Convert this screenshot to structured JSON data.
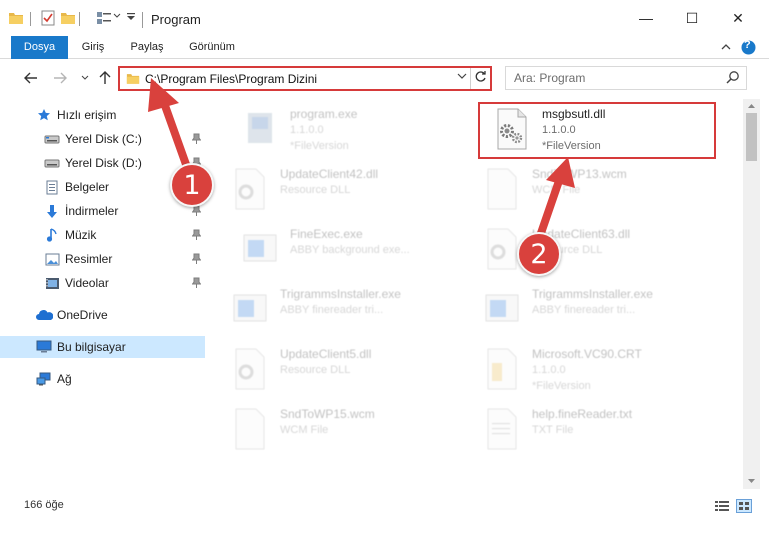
{
  "window": {
    "title": "Program",
    "minimize_glyph": "—",
    "maximize_glyph": "☐",
    "close_glyph": "✕"
  },
  "ribbon": {
    "tabs": [
      "Dosya",
      "Giriş",
      "Paylaş",
      "Görünüm"
    ],
    "help_glyph": "?"
  },
  "address": {
    "path": "C:\\Program Files\\Program Dizini",
    "search_placeholder": "Ara: Program"
  },
  "nav": {
    "items": [
      {
        "label": "Hızlı erişim",
        "icon": "star-icon"
      },
      {
        "label": "Yerel Disk (C:)",
        "icon": "drive-icon",
        "pinned": true
      },
      {
        "label": "Yerel Disk (D:)",
        "icon": "drive-icon",
        "pinned": true
      },
      {
        "label": "Belgeler",
        "icon": "documents-icon",
        "pinned": true
      },
      {
        "label": "İndirmeler",
        "icon": "download-icon",
        "pinned": true
      },
      {
        "label": "Müzik",
        "icon": "music-icon",
        "pinned": true
      },
      {
        "label": "Resimler",
        "icon": "pictures-icon",
        "pinned": true
      },
      {
        "label": "Videolar",
        "icon": "videos-icon",
        "pinned": true
      },
      {
        "label": "OneDrive",
        "icon": "onedrive-icon"
      },
      {
        "label": "Bu bilgisayar",
        "icon": "this-pc-icon",
        "selected": true
      },
      {
        "label": "Ağ",
        "icon": "network-icon"
      }
    ]
  },
  "files": [
    {
      "name": "program.exe",
      "line2": "1.1.0.0",
      "line3": "*FileVersion",
      "icon": "program-exe-icon"
    },
    {
      "name": "msgbsutl.dll",
      "line2": "1.1.0.0",
      "line3": "*FileVersion",
      "icon": "dll-gear-icon",
      "highlighted": true
    },
    {
      "name": "UpdateClient42.dll",
      "line2": "Resource DLL",
      "line3": "",
      "icon": "dll-gear-icon"
    },
    {
      "name": "SndToWP13.wcm",
      "line2": "WCM File",
      "line3": "",
      "icon": "blank-file-icon"
    },
    {
      "name": "FineExec.exe",
      "line2": "ABBY background exe...",
      "line3": "",
      "icon": "app-window-icon"
    },
    {
      "name": "UpdateClient63.dll",
      "line2": "Resource DLL",
      "line3": "",
      "icon": "dll-gear-icon"
    },
    {
      "name": "TrigrammsInstaller.exe",
      "line2": "ABBY finereader tri...",
      "line3": "",
      "icon": "app-window-icon"
    },
    {
      "name": "TrigrammsInstaller.exe",
      "line2": "ABBY finereader tri...",
      "line3": "",
      "icon": "app-window-icon"
    },
    {
      "name": "UpdateClient5.dll",
      "line2": "Resource DLL",
      "line3": "",
      "icon": "dll-gear-icon"
    },
    {
      "name": "Microsoft.VC90.CRT",
      "line2": "1.1.0.0",
      "line3": "*FileVersion",
      "icon": "folder-file-icon"
    },
    {
      "name": "SndToWP15.wcm",
      "line2": "WCM File",
      "line3": "",
      "icon": "blank-file-icon"
    },
    {
      "name": "help.fineReader.txt",
      "line2": "TXT File",
      "line3": "",
      "icon": "text-file-icon"
    }
  ],
  "status": {
    "item_count": "166 öğe"
  },
  "annotations": {
    "badge1": "1",
    "badge2": "2"
  },
  "colors": {
    "accent": "#1979ca",
    "highlight": "#d63a3a",
    "badge": "#d9413d",
    "selected_nav": "#cce8ff"
  }
}
